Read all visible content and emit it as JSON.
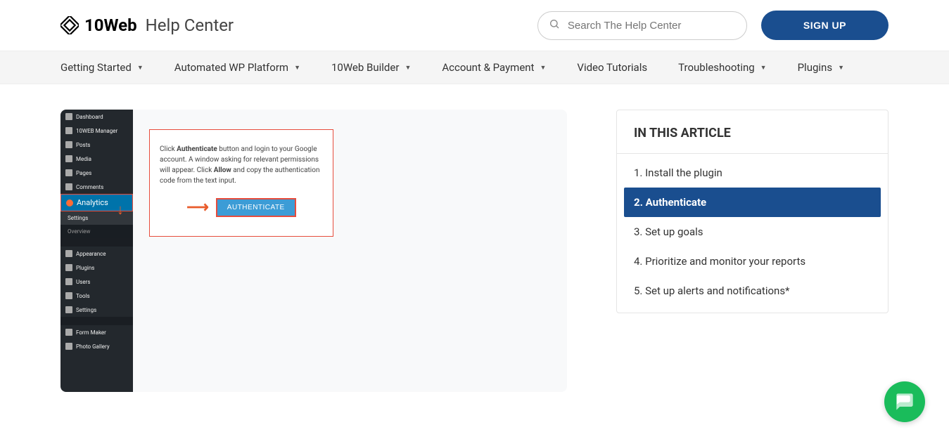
{
  "header": {
    "logo_main": "10Web",
    "logo_sub": "Help Center",
    "search_placeholder": "Search The Help Center",
    "signup_label": "SIGN UP"
  },
  "nav": {
    "items": [
      {
        "label": "Getting Started",
        "caret": true
      },
      {
        "label": "Automated WP Platform",
        "caret": true
      },
      {
        "label": "10Web Builder",
        "caret": true
      },
      {
        "label": "Account & Payment",
        "caret": true
      },
      {
        "label": "Video Tutorials",
        "caret": false
      },
      {
        "label": "Troubleshooting",
        "caret": true
      },
      {
        "label": "Plugins",
        "caret": true
      }
    ]
  },
  "wp_sidebar": {
    "items": [
      "Dashboard",
      "10WEB Manager",
      "Posts",
      "Media",
      "Pages",
      "Comments",
      "Analytics",
      "Settings",
      "Overview",
      "Appearance",
      "Plugins",
      "Users",
      "Tools",
      "Settings",
      "Form Maker",
      "Photo Gallery"
    ]
  },
  "instruct": {
    "p1_a": "Click ",
    "p1_b": "Authenticate",
    "p1_c": " button and login to your Google account. A window asking for relevant permissions will appear. Click ",
    "p1_d": "Allow",
    "p1_e": " and copy the authentication code from the text input.",
    "auth_btn": "AUTHENTICATE"
  },
  "toc": {
    "header": "IN THIS ARTICLE",
    "items": [
      {
        "label": "1. Install the plugin",
        "active": false
      },
      {
        "label": "2. Authenticate",
        "active": true
      },
      {
        "label": "3. Set up goals",
        "active": false
      },
      {
        "label": "4. Prioritize and monitor your reports",
        "active": false
      },
      {
        "label": "5. Set up alerts and notifications*",
        "active": false
      }
    ]
  }
}
